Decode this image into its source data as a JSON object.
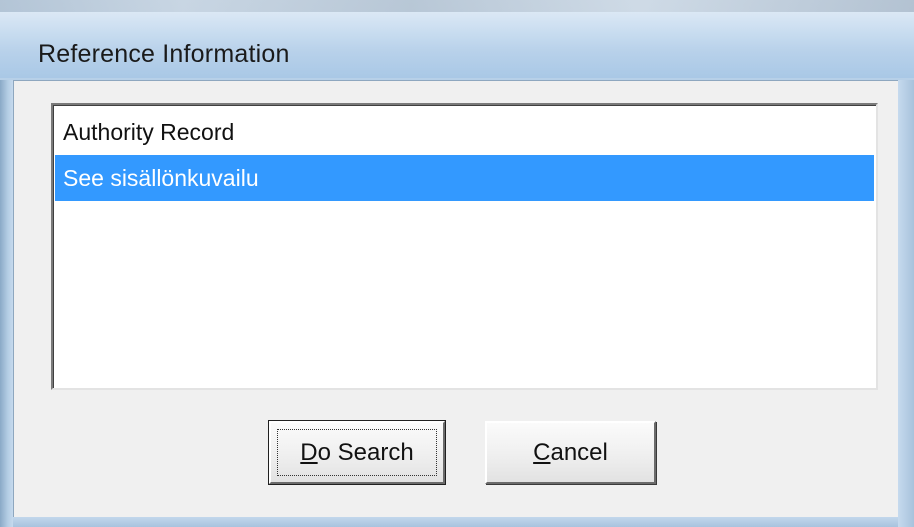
{
  "window": {
    "title": "Reference Information"
  },
  "list": {
    "items": [
      {
        "label": "Authority Record",
        "selected": false
      },
      {
        "label": "See sisällönkuvailu",
        "selected": true
      }
    ]
  },
  "buttons": {
    "search": {
      "mnemonic": "D",
      "rest": "o Search"
    },
    "cancel": {
      "mnemonic": "C",
      "rest": "ancel"
    }
  },
  "colors": {
    "selection": "#3399ff",
    "selection_text": "#ffffff",
    "dialog_face": "#f0f0f0",
    "frame": "#b6cfe7"
  }
}
